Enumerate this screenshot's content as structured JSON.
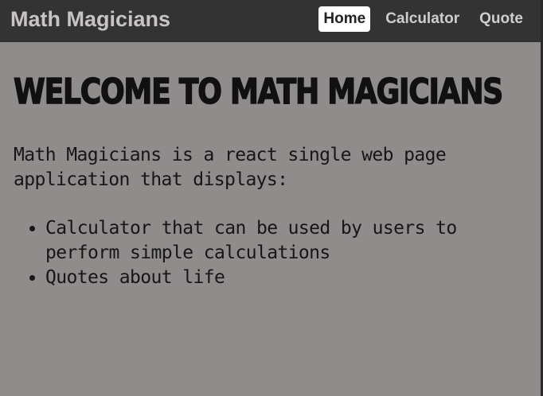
{
  "navbar": {
    "brand": "Math Magicians",
    "links": [
      {
        "label": "Home",
        "active": true
      },
      {
        "label": "Calculator",
        "active": false
      },
      {
        "label": "Quote",
        "active": false
      }
    ]
  },
  "main": {
    "title": "WELCOME TO MATH MAGICIANS",
    "intro": "Math Magicians is a react single web page application that displays:",
    "features": [
      "Calculator that can be used by users to perform simple calculations",
      "Quotes about life"
    ]
  },
  "colors": {
    "navbar_bg": "#333333",
    "page_bg": "#8f8c8b",
    "active_link_bg": "#ffffff"
  }
}
